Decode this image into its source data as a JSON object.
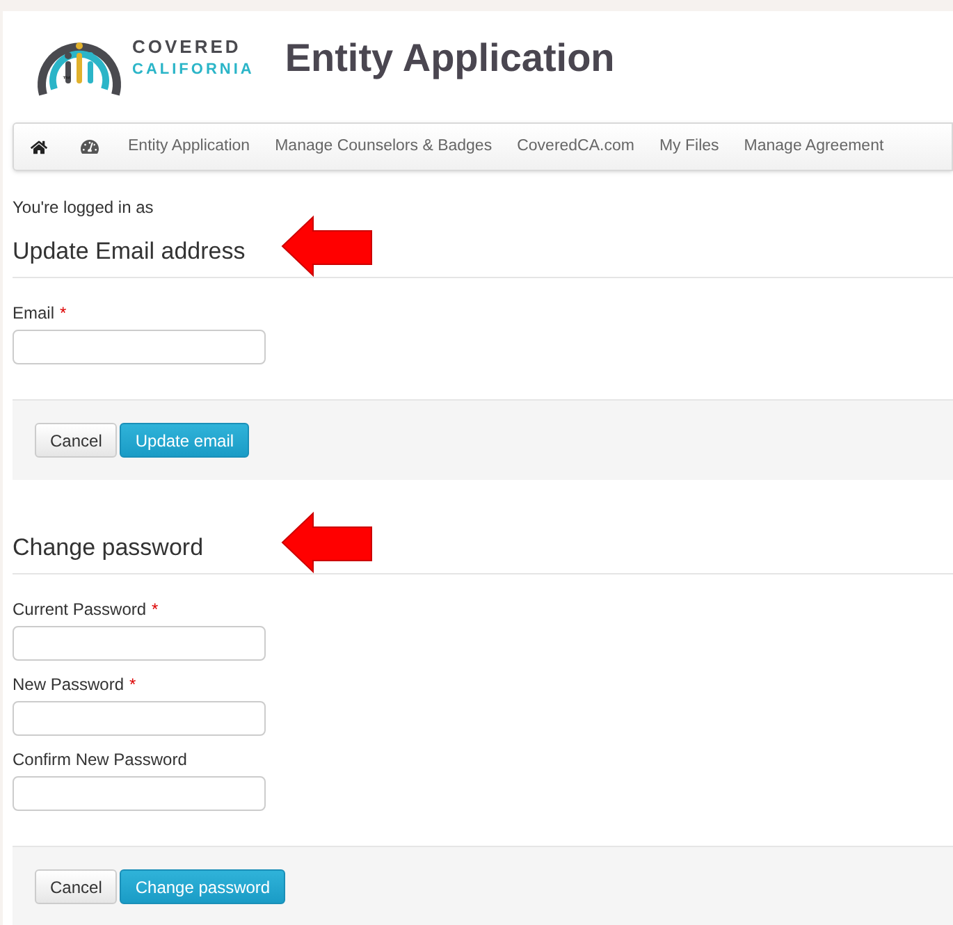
{
  "header": {
    "logo_line_1": "COVERED",
    "logo_line_2": "CALIFORNIA",
    "logo_mark": "™",
    "title": "Entity Application"
  },
  "nav": [
    {
      "kind": "home"
    },
    {
      "kind": "dashboard"
    },
    {
      "kind": "link",
      "label": "Entity Application"
    },
    {
      "kind": "link",
      "label": "Manage Counselors & Badges"
    },
    {
      "kind": "link",
      "label": "CoveredCA.com"
    },
    {
      "kind": "link",
      "label": "My Files"
    },
    {
      "kind": "link",
      "label": "Manage Agreement"
    }
  ],
  "logged_in_text": "You're logged in as",
  "sections": [
    {
      "heading": "Update Email address",
      "arrow": true,
      "fields": [
        {
          "label": "Email",
          "required_mark": "*"
        }
      ],
      "buttons": [
        {
          "label": "Cancel",
          "kind": "default"
        },
        {
          "label": "Update email",
          "kind": "primary"
        }
      ]
    },
    {
      "heading": "Change password",
      "arrow": true,
      "fields": [
        {
          "label": "Current Password",
          "required_mark": "*"
        },
        {
          "label": "New Password",
          "required_mark": "*"
        },
        {
          "label": "Confirm New Password"
        }
      ],
      "buttons": [
        {
          "label": "Cancel",
          "kind": "default"
        },
        {
          "label": "Change password",
          "kind": "primary"
        }
      ]
    }
  ]
}
